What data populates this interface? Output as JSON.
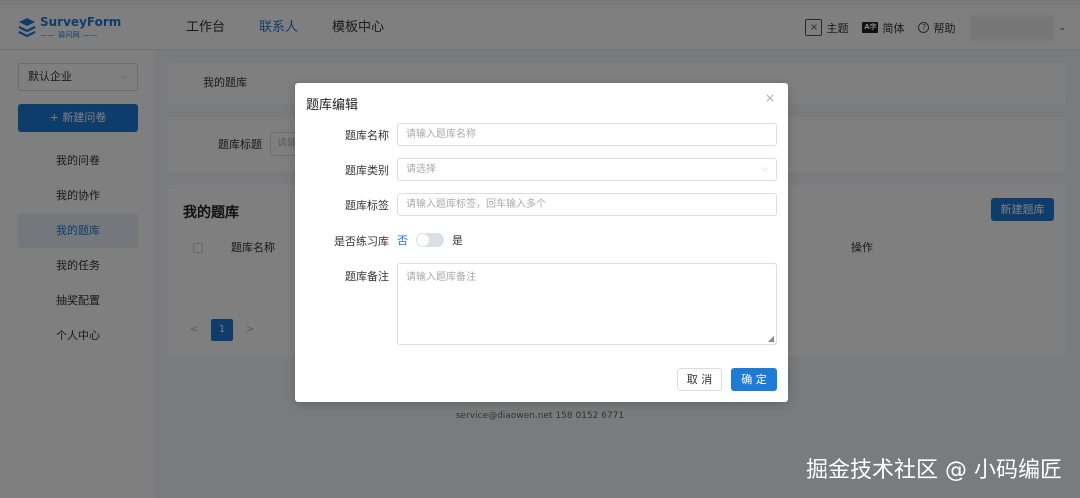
{
  "logo": {
    "title": "SurveyForm",
    "subtitle": "—— 调问网 ——"
  },
  "nav": {
    "items": [
      "工作台",
      "联系人",
      "模板中心"
    ],
    "active": "联系人"
  },
  "top_right": {
    "theme_icon": "×",
    "theme": "主题",
    "lang_icon": "A字",
    "lang": "简体",
    "help_icon": "?",
    "help": "帮助",
    "caret": "⌄"
  },
  "sidebar": {
    "company": "默认企业",
    "new_survey": "+ 新建问卷",
    "items": [
      "我的问卷",
      "我的协作",
      "我的题库",
      "我的任务",
      "抽奖配置",
      "个人中心"
    ],
    "active": "我的题库"
  },
  "main": {
    "breadcrumb": "我的题库",
    "filter_label": "题库标题",
    "filter_placeholder": "请输",
    "list_title": "我的题库",
    "new_bank_button": "新建题库",
    "columns": {
      "name": "题库名称",
      "operation": "操作"
    },
    "pager": {
      "prev": "<",
      "page": "1",
      "next": ">"
    }
  },
  "footer": {
    "contact": "service@diaowen.net 158 0152 6771"
  },
  "modal": {
    "title": "题库编辑",
    "close": "×",
    "fields": {
      "name_label": "题库名称",
      "name_placeholder": "请输入题库名称",
      "category_label": "题库类别",
      "category_placeholder": "请选择",
      "tags_label": "题库标签",
      "tags_placeholder": "请输入题库标签，回车输入多个",
      "practice_label": "是否练习库",
      "practice_off": "否",
      "practice_on": "是",
      "practice_value": false,
      "remark_label": "题库备注",
      "remark_placeholder": "请输入题库备注"
    },
    "cancel": "取 消",
    "confirm": "确 定"
  },
  "watermark": "掘金技术社区 @ 小码编匠",
  "colors": {
    "primary": "#1e7bd6",
    "overlay": "rgba(0,0,0,0.5)"
  }
}
